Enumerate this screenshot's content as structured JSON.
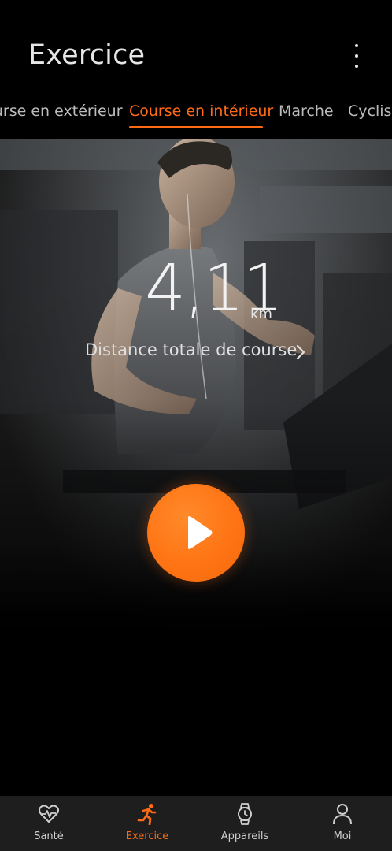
{
  "header": {
    "title": "Exercice",
    "more_icon": "more-vertical-icon"
  },
  "tabs": [
    {
      "label": "Course en extérieur",
      "active": false
    },
    {
      "label": "Course en intérieur",
      "active": true
    },
    {
      "label": "Marche",
      "active": false
    },
    {
      "label": "Cyclisme",
      "active": false
    }
  ],
  "hero": {
    "distance_value": "4,11",
    "distance_unit": "km",
    "caption": "Distance totale de course",
    "caption_icon": "chevron-right-icon",
    "start_icon": "play-icon"
  },
  "colors": {
    "accent": "#ff6a14",
    "background": "#000000",
    "nav_background": "#1e1e1e"
  },
  "bottom_nav": [
    {
      "label": "Santé",
      "icon": "heart-pulse-icon",
      "active": false
    },
    {
      "label": "Exercice",
      "icon": "running-person-icon",
      "active": true
    },
    {
      "label": "Appareils",
      "icon": "smartwatch-icon",
      "active": false
    },
    {
      "label": "Moi",
      "icon": "person-icon",
      "active": false
    }
  ]
}
